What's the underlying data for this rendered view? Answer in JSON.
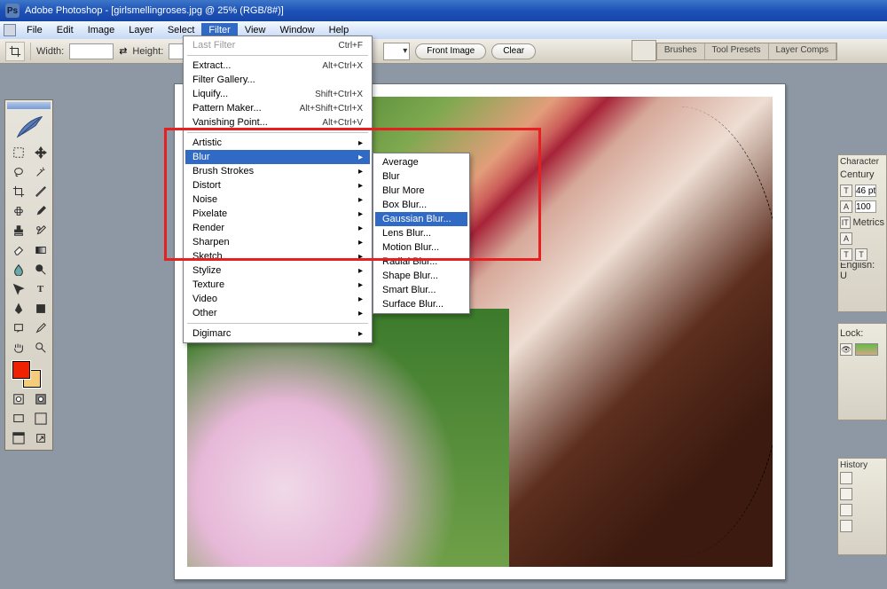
{
  "app": {
    "title": "Adobe Photoshop - [girlsmellingroses.jpg @ 25% (RGB/8#)]"
  },
  "menubar": [
    "File",
    "Edit",
    "Image",
    "Layer",
    "Select",
    "Filter",
    "View",
    "Window",
    "Help"
  ],
  "menubar_open": "Filter",
  "optbar": {
    "width_label": "Width:",
    "height_label": "Height:",
    "width_value": "",
    "height_value": "",
    "front_image": "Front Image",
    "clear": "Clear"
  },
  "filter_menu": {
    "last_filter": "Last Filter",
    "last_filter_sc": "Ctrl+F",
    "top_items": [
      {
        "label": "Extract...",
        "sc": "Alt+Ctrl+X"
      },
      {
        "label": "Filter Gallery...",
        "sc": ""
      },
      {
        "label": "Liquify...",
        "sc": "Shift+Ctrl+X"
      },
      {
        "label": "Pattern Maker...",
        "sc": "Alt+Shift+Ctrl+X"
      },
      {
        "label": "Vanishing Point...",
        "sc": "Alt+Ctrl+V"
      }
    ],
    "categories": [
      "Artistic",
      "Blur",
      "Brush Strokes",
      "Distort",
      "Noise",
      "Pixelate",
      "Render",
      "Sharpen",
      "Sketch",
      "Stylize",
      "Texture",
      "Video",
      "Other"
    ],
    "highlighted_category": "Blur",
    "digimarc": "Digimarc"
  },
  "blur_submenu": [
    "Average",
    "Blur",
    "Blur More",
    "Box Blur...",
    "Gaussian Blur...",
    "Lens Blur...",
    "Motion Blur...",
    "Radial Blur...",
    "Shape Blur...",
    "Smart Blur...",
    "Surface Blur..."
  ],
  "blur_submenu_highlighted": "Gaussian Blur...",
  "panel_tabs": [
    "Brushes",
    "Tool Presets",
    "Layer Comps"
  ],
  "char_panel": {
    "title": "Character",
    "font": "Century",
    "size": "46 pt",
    "leading": "100",
    "tracking": "Metrics",
    "lang": "English: U"
  },
  "layers_panel": {
    "lock_label": "Lock:"
  },
  "history_panel": {
    "title": "History"
  },
  "colors": {
    "fg": "#ee2200",
    "bg": "#f5cc7a"
  }
}
